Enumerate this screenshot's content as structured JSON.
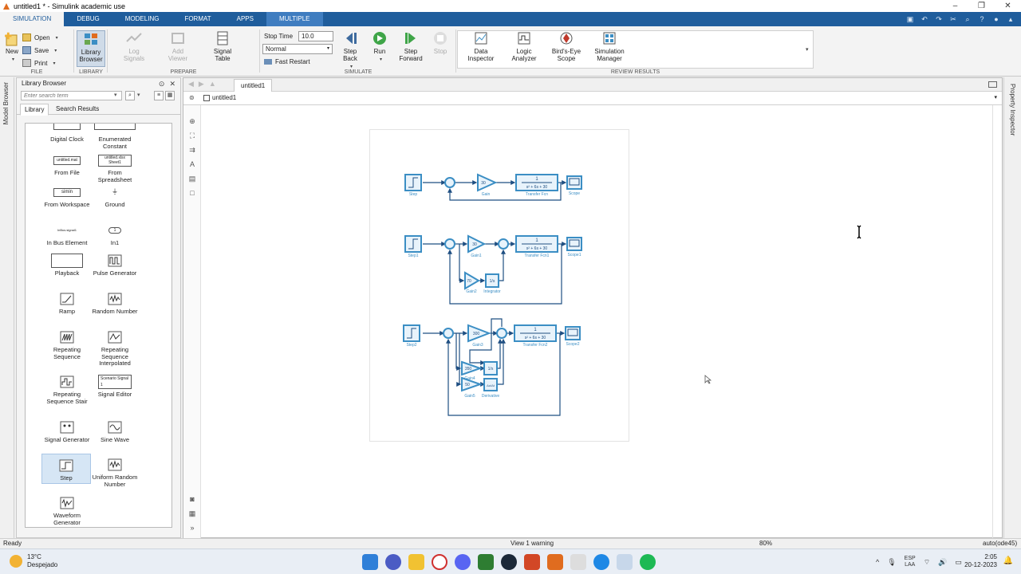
{
  "window": {
    "title": "untitled1 * - Simulink academic use"
  },
  "ribbon_tabs": [
    "SIMULATION",
    "DEBUG",
    "MODELING",
    "FORMAT",
    "APPS",
    "MULTIPLE"
  ],
  "file_group": {
    "label": "FILE",
    "new": "New",
    "open": "Open",
    "save": "Save",
    "print": "Print"
  },
  "library_group": {
    "label": "LIBRARY",
    "browser": "Library Browser"
  },
  "prepare_group": {
    "label": "PREPARE",
    "log_signals": "Log Signals",
    "add_viewer": "Add Viewer",
    "signal_table": "Signal Table"
  },
  "simulate_group": {
    "label": "SIMULATE",
    "stop_time_label": "Stop Time",
    "stop_time_value": "10.0",
    "mode": "Normal",
    "fast_restart": "Fast Restart",
    "step_back": "Step Back",
    "run": "Run",
    "step_forward": "Step Forward",
    "stop": "Stop"
  },
  "review_group": {
    "label": "REVIEW RESULTS",
    "data_inspector": "Data Inspector",
    "logic_analyzer": "Logic Analyzer",
    "birds_eye": "Bird's-Eye Scope",
    "sim_manager": "Simulation Manager"
  },
  "left_strip": {
    "model_browser": "Model Browser"
  },
  "library_browser": {
    "title": "Library Browser",
    "search_placeholder": "Enter search term",
    "tabs": [
      "Library",
      "Search Results"
    ],
    "items": [
      {
        "label": "Digital Clock"
      },
      {
        "label": "Enumerated Constant"
      },
      {
        "label": "From File",
        "thumb": "untitled.mat"
      },
      {
        "label": "From Spreadsheet",
        "thumb": "untitled.xlsx Sheet1"
      },
      {
        "label": "From Workspace",
        "thumb": "simin"
      },
      {
        "label": "Ground"
      },
      {
        "label": "In Bus Element",
        "thumb": "InBus.signal1"
      },
      {
        "label": "In1",
        "thumb": "1"
      },
      {
        "label": "Playback"
      },
      {
        "label": "Pulse Generator"
      },
      {
        "label": "Ramp"
      },
      {
        "label": "Random Number"
      },
      {
        "label": "Repeating Sequence"
      },
      {
        "label": "Repeating Sequence Interpolated"
      },
      {
        "label": "Repeating Sequence Stair"
      },
      {
        "label": "Signal Editor",
        "thumb": "Scenario Signal 1"
      },
      {
        "label": "Signal Generator"
      },
      {
        "label": "Sine Wave"
      },
      {
        "label": "Step"
      },
      {
        "label": "Uniform Random Number"
      },
      {
        "label": "Waveform Generator"
      }
    ]
  },
  "editor": {
    "tab": "untitled1",
    "breadcrumb": "untitled1"
  },
  "diagram": {
    "tf_num": "1",
    "tf_den": "s² + 6s + 30",
    "row1": {
      "step": "Step",
      "gain_value": "30",
      "gain": "Gain",
      "tf": "Transfer Fcn",
      "scope": "Scope"
    },
    "row2": {
      "step": "Step1",
      "gain1_value": "30",
      "gain1": "Gain1",
      "gain2_value": "70",
      "gain2": "Gain2",
      "integrator": "Integrator",
      "integrator_symbol": "1/s",
      "tf": "Transfer Fcn1",
      "scope": "Scope1"
    },
    "row3": {
      "step": "Step2",
      "gain3_value": "300",
      "gain3": "Gain3",
      "gain4_value": "350",
      "gain4": "Gain4",
      "gain5_value": "50",
      "gain5": "Gain5",
      "integrator_symbol": "1/s",
      "derivative_symbol": "Δu/Δt",
      "derivative": "Derivative",
      "tf": "Transfer Fcn2",
      "scope": "Scope2"
    }
  },
  "right_strip": {
    "property_inspector": "Property Inspector"
  },
  "status": {
    "left": "Ready",
    "center": "View 1 warning",
    "zoom": "80%",
    "solver": "auto(ode45)"
  },
  "taskbar": {
    "temp": "13°C",
    "weather": "Despejado",
    "lang1": "ESP",
    "lang2": "LAA",
    "time": "2:05",
    "date": "20-12-2023"
  },
  "colors": {
    "accent": "#1f5d9c",
    "block": "#3b8ec4",
    "block_fill": "#e8f3fb"
  }
}
